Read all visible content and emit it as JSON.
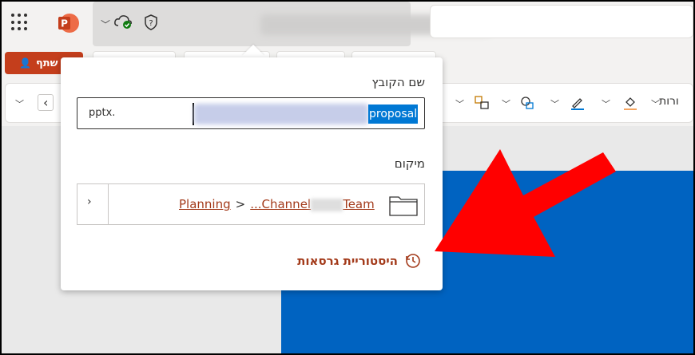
{
  "header": {
    "app_name": "PowerPoint",
    "app_logo_letter": "P",
    "chevron": "chevron-down-icon",
    "cloud_status_icon": "cloud-saved-icon",
    "shield_icon": "shield-icon"
  },
  "toolbar": {
    "share_label": "שתף",
    "ribbon_label": "ורות"
  },
  "popup": {
    "filename_label": "שם הקובץ",
    "filename_extension": "pptx.",
    "filename_selected": "proposal",
    "location_label": "מיקום",
    "location_crumbs": [
      "Planning",
      "...Channel",
      "Team"
    ],
    "crumb_separator": ">",
    "history_label": "היסטוריית גרסאות"
  },
  "colors": {
    "accent": "#c43e1c",
    "slide_blue": "#0063c1",
    "link": "#a33a1a",
    "selection": "#0078d4",
    "arrow": "#ff0000"
  }
}
